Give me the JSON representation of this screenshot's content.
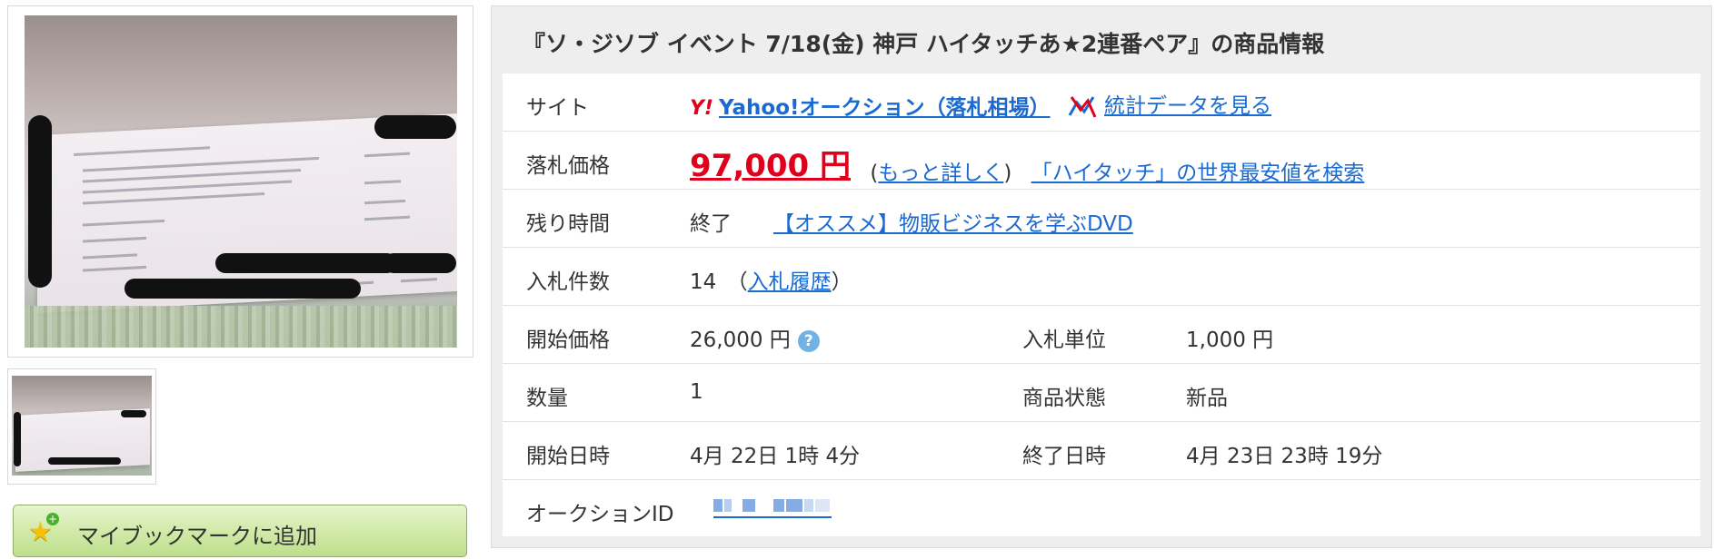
{
  "left": {
    "bookmark_label": "マイブックマークに追加"
  },
  "panel": {
    "title": "『ソ・ジソブ イベント 7/18(金) 神戸 ハイタッチあ★2連番ペア』の商品情報",
    "site": {
      "label": "サイト",
      "yahoo_icon": "Y!",
      "yahoo_link": "Yahoo!オークション（落札相場）",
      "stats_link": "統計データを見る"
    },
    "price": {
      "label": "落札価格",
      "value": "97,000 円",
      "paren_open": "(",
      "more_link": "もっと詳しく",
      "paren_close": ")",
      "search_link": "「ハイタッチ」の世界最安値を検索"
    },
    "remaining": {
      "label": "残り時間",
      "value": "終了",
      "promo_link": "【オススメ】物販ビジネスを学ぶDVD"
    },
    "bids": {
      "label": "入札件数",
      "value": "14",
      "paren_open": "（",
      "history_link": "入札履歴",
      "paren_close": "）"
    },
    "start_price": {
      "label": "開始価格",
      "value": "26,000 円",
      "help_icon": "?"
    },
    "bid_unit": {
      "label": "入札単位",
      "value": "1,000 円"
    },
    "quantity": {
      "label": "数量",
      "value": "1"
    },
    "condition": {
      "label": "商品状態",
      "value": "新品"
    },
    "start_time": {
      "label": "開始日時",
      "value": "4月 22日 1時 4分"
    },
    "end_time": {
      "label": "終了日時",
      "value": "4月 23日 23時 19分"
    },
    "auction_id": {
      "label": "オークションID"
    }
  },
  "colors": {
    "price_red": "#e0001b",
    "link_blue": "#1a6ad1",
    "button_green": "#cfe9a6"
  }
}
